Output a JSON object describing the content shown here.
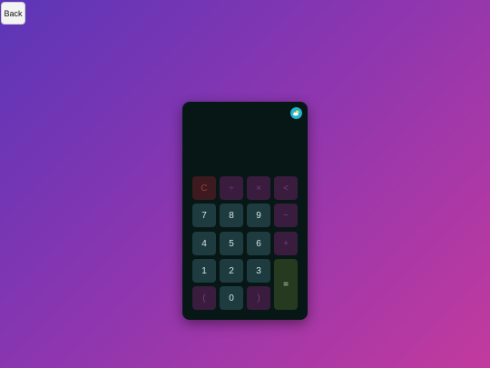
{
  "nav": {
    "back_label": "Back"
  },
  "calculator": {
    "display_value": "",
    "theme_toggle_icon": "sun-cloud-icon",
    "keys": {
      "clear": "C",
      "divide": "÷",
      "multiply": "×",
      "backspace": "<",
      "seven": "7",
      "eight": "8",
      "nine": "9",
      "subtract": "−",
      "four": "4",
      "five": "5",
      "six": "6",
      "add": "+",
      "one": "1",
      "two": "2",
      "three": "3",
      "equals": "=",
      "open_paren": "(",
      "zero": "0",
      "close_paren": ")"
    }
  },
  "colors": {
    "background_start": "#5b36b8",
    "background_end": "#c23a9e",
    "calculator_bg": "#071716",
    "number_key": "#1e3c40",
    "operator_key": "#3a1c3e",
    "clear_key": "#3c1a20",
    "equals_key": "#263a20",
    "toggle": "#22b3cf"
  }
}
